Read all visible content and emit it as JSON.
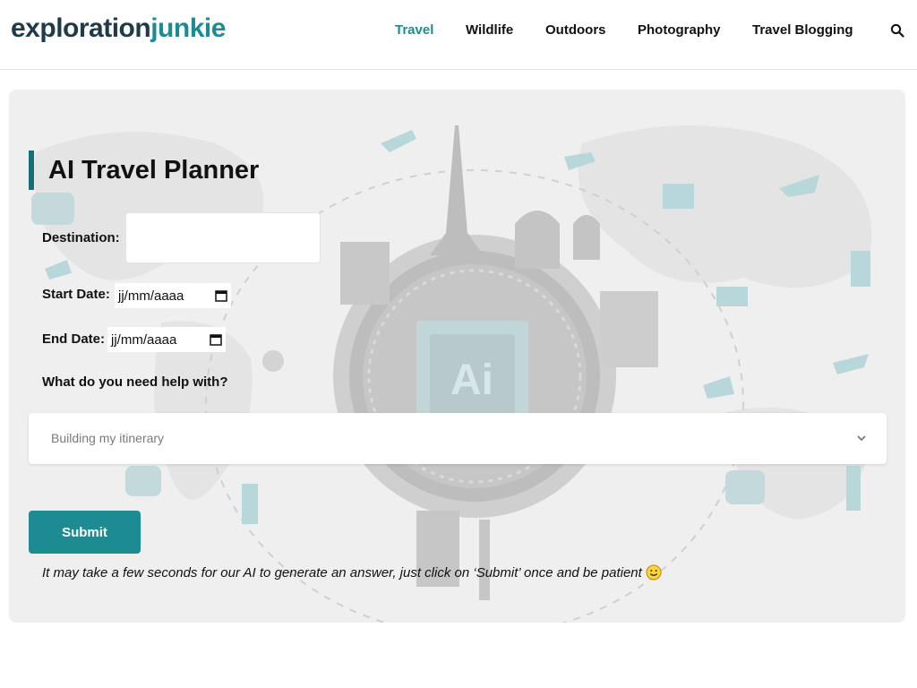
{
  "brand": {
    "part1": "exploration",
    "part2": "junkie"
  },
  "nav": {
    "items": [
      {
        "label": "Travel",
        "active": true
      },
      {
        "label": "Wildlife",
        "active": false
      },
      {
        "label": "Outdoors",
        "active": false
      },
      {
        "label": "Photography",
        "active": false
      },
      {
        "label": "Travel Blogging",
        "active": false
      }
    ],
    "search_icon": "search-icon"
  },
  "planner": {
    "title": "AI Travel Planner",
    "destination_label": "Destination:",
    "destination_value": "",
    "start_label": "Start Date:",
    "start_placeholder": "jj/mm/aaaa",
    "end_label": "End Date:",
    "end_placeholder": "jj/mm/aaaa",
    "help_label": "What do you need help with?",
    "help_selected": "Building my itinerary",
    "submit_label": "Submit",
    "note": "It may take a few seconds for our AI to generate an answer, just click on ‘Submit’ once and be patient",
    "background_badge": "Ai"
  },
  "colors": {
    "accent": "#1d8c92",
    "title_bar": "#146f76",
    "logo_dark": "#1f3a4b",
    "card_bg": "#efefef"
  }
}
